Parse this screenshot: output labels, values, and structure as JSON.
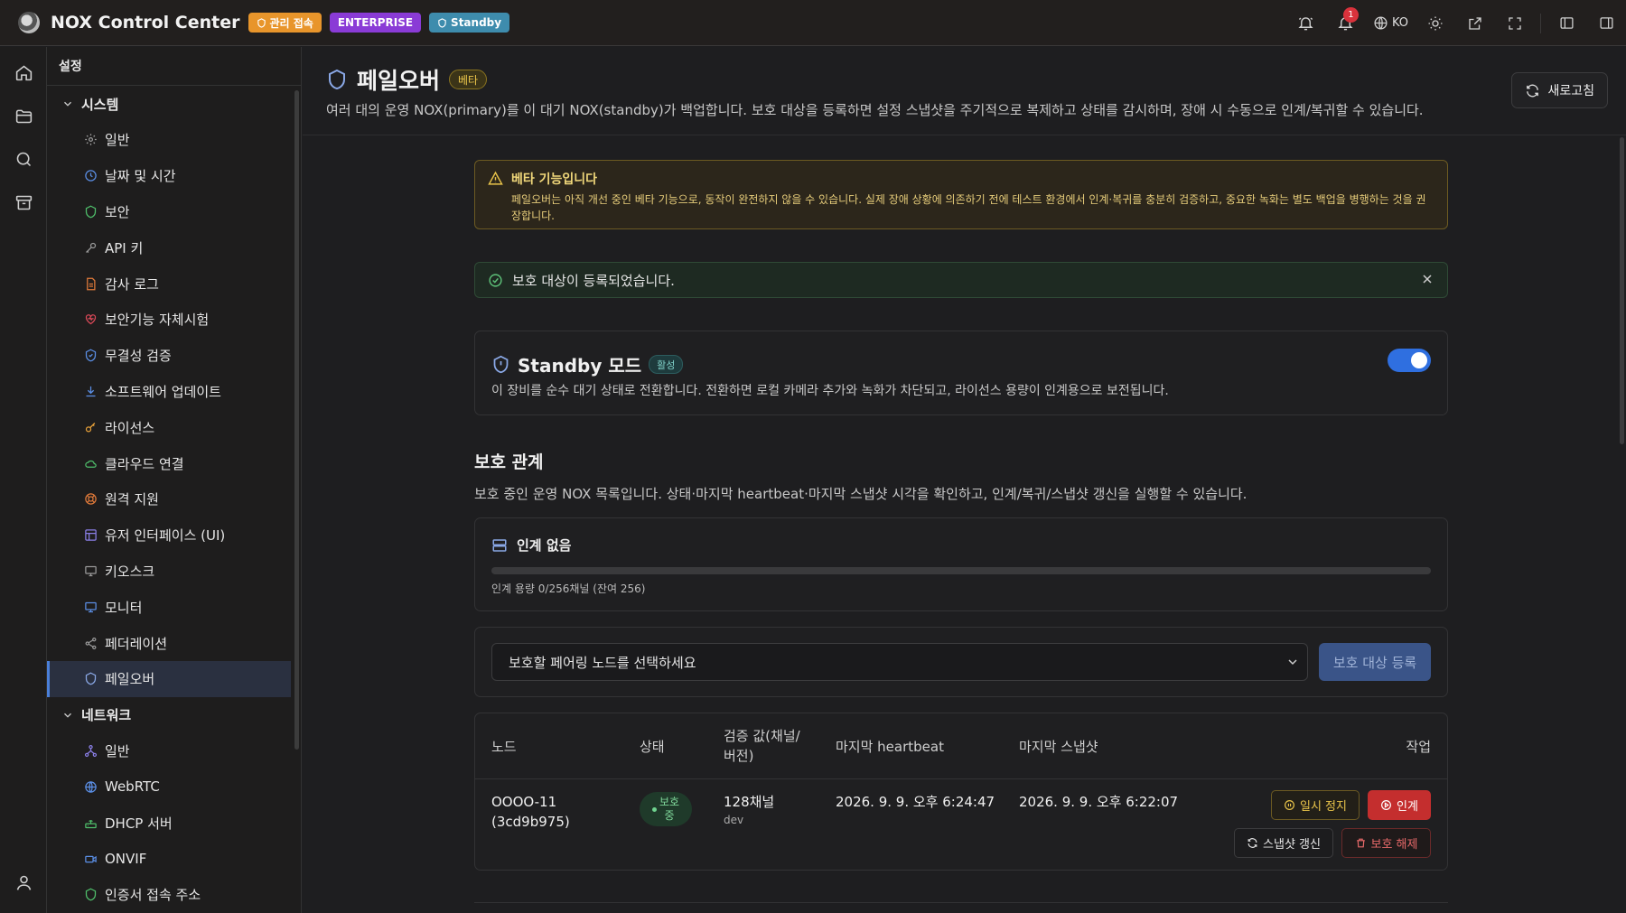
{
  "topbar": {
    "app_title": "NOX Control Center",
    "badges": {
      "admin": "관리 접속",
      "enterprise": "ENTERPRISE",
      "standby": "Standby"
    },
    "notification_count": "1",
    "language": "KO"
  },
  "sidebar": {
    "header": "설정",
    "groups": [
      {
        "label": "시스템",
        "items": [
          "일반",
          "날짜 및 시간",
          "보안",
          "API 키",
          "감사 로그",
          "보안기능 자체시험",
          "무결성 검증",
          "소프트웨어 업데이트",
          "라이선스",
          "클라우드 연결",
          "원격 지원",
          "유저 인터페이스 (UI)",
          "키오스크",
          "모니터",
          "페더레이션",
          "페일오버"
        ]
      },
      {
        "label": "네트워크",
        "items": [
          "일반",
          "WebRTC",
          "DHCP 서버",
          "ONVIF",
          "인증서 접속 주소"
        ]
      }
    ],
    "active_item": "페일오버"
  },
  "page": {
    "title": "페일오버",
    "beta_badge": "베타",
    "description": "여러 대의 운영 NOX(primary)를 이 대기 NOX(standby)가 백업합니다. 보호 대상을 등록하면 설정 스냅샷을 주기적으로 복제하고 상태를 감시하며, 장애 시 수동으로 인계/복귀할 수 있습니다.",
    "refresh_label": "새로고침"
  },
  "warning": {
    "title": "베타 기능입니다",
    "body": "페일오버는 아직 개선 중인 베타 기능으로, 동작이 완전하지 않을 수 있습니다. 실제 장애 상황에 의존하기 전에 테스트 환경에서 인계·복귀를 충분히 검증하고, 중요한 녹화는 별도 백업을 병행하는 것을 권장합니다."
  },
  "success": {
    "message": "보호 대상이 등록되었습니다."
  },
  "standby_mode": {
    "title": "Standby 모드",
    "status": "활성",
    "description": "이 장비를 순수 대기 상태로 전환합니다. 전환하면 로컬 카메라 추가와 녹화가 차단되고, 라이선스 용량이 인계용으로 보전됩니다.",
    "enabled": true
  },
  "protection": {
    "title": "보호 관계",
    "description": "보호 중인 운영 NOX 목록입니다. 상태·마지막 heartbeat·마지막 스냅샷 시각을 확인하고, 인계/복귀/스냅샷 갱신을 실행할 수 있습니다.",
    "capacity": {
      "title": "인계 없음",
      "text": "인계 용량 0/256채널 (잔여 256)",
      "used": 0,
      "total": 256
    },
    "select_placeholder": "보호할 페어링 노드를 선택하세요",
    "register_label": "보호 대상 등록",
    "columns": {
      "node": "노드",
      "status": "상태",
      "verify_line1": "검증 값(채널/",
      "verify_line2": "버전)",
      "heartbeat": "마지막 heartbeat",
      "snapshot": "마지막 스냅샷",
      "actions": "작업"
    },
    "rows": [
      {
        "node_line1": "OOOO-11",
        "node_line2": "(3cd9b975)",
        "status_line1": "보호",
        "status_line2": "중",
        "channels": "128채널",
        "version": "dev",
        "heartbeat": "2026. 9. 9. 오후 6:24:47",
        "snapshot": "2026. 9. 9. 오후 6:22:07",
        "actions": {
          "pause": "일시 정지",
          "failover": "인계",
          "snapshot": "스냅샷 갱신",
          "unprotect": "보호 해제"
        }
      }
    ]
  },
  "colors": {
    "accent": "#2f6fe0",
    "danger": "#c42e2e",
    "warning": "#e9c44a",
    "success": "#5ec27a"
  }
}
